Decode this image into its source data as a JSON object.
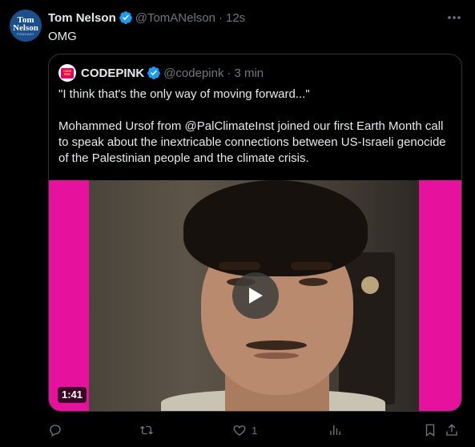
{
  "tweet": {
    "avatar_text": [
      "Tom",
      "Nelson",
      "PODCAST"
    ],
    "author_name": "Tom Nelson",
    "author_handle": "@TomANelson",
    "separator": "·",
    "time": "12s",
    "text": "OMG"
  },
  "quote": {
    "avatar_text": [
      "CODE",
      "PINK"
    ],
    "author_name": "CODEPINK",
    "author_handle": "@codepink",
    "separator": "·",
    "time": "3 min",
    "paragraph_1": "\"I think that's the only way of moving forward...\"",
    "paragraph_2": "Mohammed Ursof from @PalClimateInst  joined our first Earth Month call to speak about the inextricable connections between US-Israeli genocide of the Palestinian people and the climate crisis.",
    "video_duration": "1:41"
  },
  "actions": {
    "reply_count": "",
    "retweet_count": "",
    "like_count": "1",
    "views_count": ""
  },
  "icons": {
    "verified": "verified-badge-icon",
    "more": "more-icon",
    "play": "play-icon",
    "reply": "reply-icon",
    "retweet": "retweet-icon",
    "like": "like-icon",
    "views": "views-icon",
    "bookmark": "bookmark-icon",
    "share": "share-icon"
  },
  "colors": {
    "background": "#000000",
    "text": "#e7e9ea",
    "muted": "#71767b",
    "verified": "#1d9bf0",
    "border": "#2f3336",
    "media_border": "#e6119c"
  }
}
